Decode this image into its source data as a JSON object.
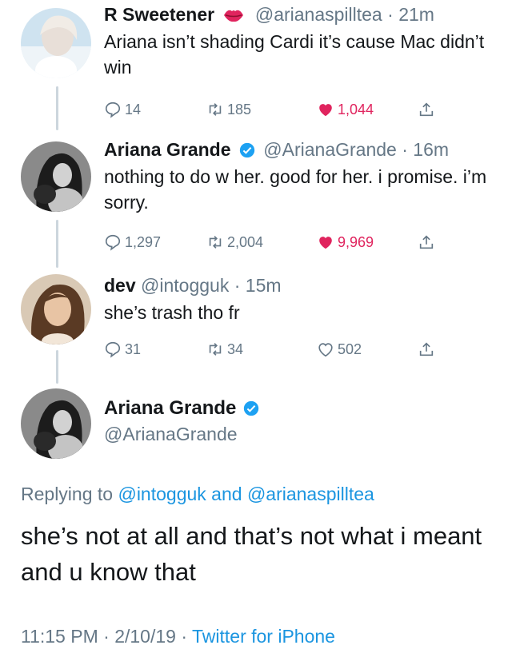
{
  "tweets": [
    {
      "name": "R Sweetener",
      "handle": "@arianaspilltea",
      "separator": "·",
      "time": "21m",
      "text": "Ariana isn’t shading Cardi it’s cause Mac didn’t win",
      "replies": "14",
      "retweets": "185",
      "likes": "1,044",
      "liked": true,
      "name_emoji": "lips-icon"
    },
    {
      "name": "Ariana Grande",
      "handle": "@ArianaGrande",
      "separator": "·",
      "time": "16m",
      "text": "nothing to do w her. good for her. i promise. i’m sorry.",
      "replies": "1,297",
      "retweets": "2,004",
      "likes": "9,969",
      "liked": true,
      "verified": true
    },
    {
      "name": "dev",
      "handle": "@intogguk",
      "separator": "·",
      "time": "15m",
      "text": "she’s trash tho fr",
      "replies": "31",
      "retweets": "34",
      "likes": "502",
      "liked": false
    }
  ],
  "main_tweet": {
    "name": "Ariana Grande",
    "handle": "@ArianaGrande",
    "verified": true,
    "replying_prefix": "Replying to",
    "replying_user1": "@intogguk",
    "replying_and": "and",
    "replying_user2": "@arianaspilltea",
    "text": "she’s not at all and that’s not what i meant and u know that",
    "time": "11:15 PM",
    "separator": "·",
    "date": "2/10/19",
    "source": "Twitter for iPhone"
  },
  "colors": {
    "like": "#e0245e",
    "link": "#1b95e0",
    "verified": "#1da1f2",
    "muted": "#657786"
  }
}
